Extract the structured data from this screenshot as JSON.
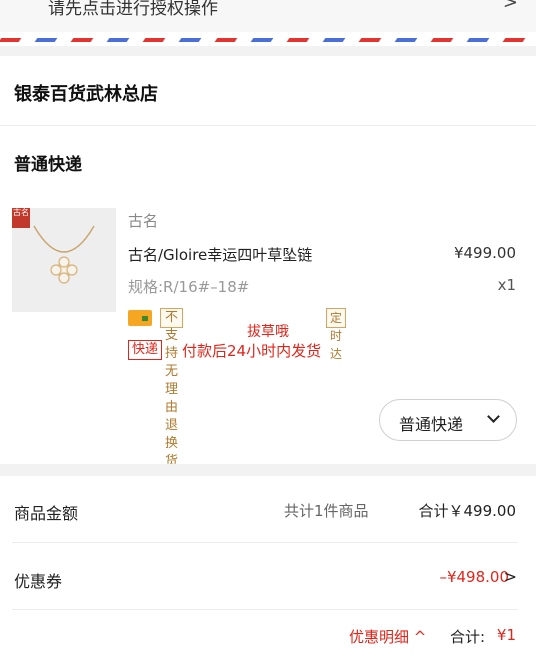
{
  "auth": {
    "text": "请先点击进行授权操作",
    "chevron": ">"
  },
  "store": {
    "name": "银泰百货武林总店"
  },
  "shipping": {
    "title": "普通快递",
    "select_label": "普通快递",
    "chevron_icon": "chevron-down-icon"
  },
  "product": {
    "thumb_badge": "古名",
    "brand": "古名",
    "name": "古名/Gloire幸运四叶草坠链",
    "price": "¥499.00",
    "spec": "规格:R/16#–18#",
    "qty": "x1",
    "tag_no_return": "不支持无理由退换货",
    "tag_on_time": "定时达",
    "overlay_text": "拔草哦",
    "express_badge": "快递",
    "delivery_text": "付款后24小时内发货"
  },
  "summary": {
    "amount_label": "商品金额",
    "amount_count": "共计1件商品",
    "amount_total": "合计￥499.00",
    "coupon_label": "优惠券",
    "coupon_value": "–¥498.00",
    "coupon_chevron": ">",
    "detail_link": "优惠明细 ^",
    "total_label": "合计:",
    "total_value": "¥1"
  },
  "colors": {
    "accent_red": "#e1251b",
    "stripe_red": "#e3342f",
    "stripe_blue": "#4a6fd8"
  }
}
